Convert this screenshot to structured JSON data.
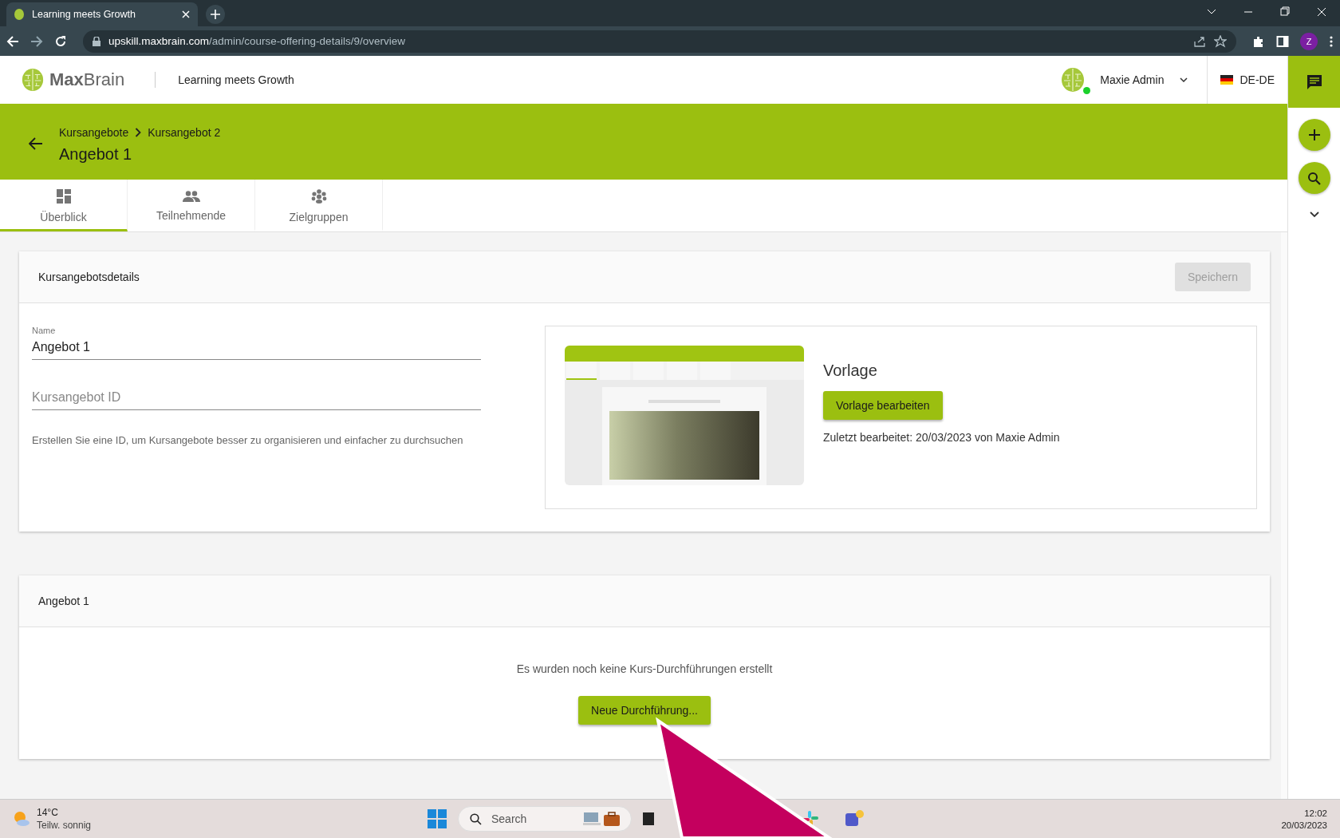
{
  "browser": {
    "tab_title": "Learning meets Growth",
    "url_host": "upskill.maxbrain.com",
    "url_path": "/admin/course-offering-details/9/overview",
    "profile_initial": "Z"
  },
  "header": {
    "logo_bold": "Max",
    "logo_light": "Brain",
    "tagline": "Learning meets Growth",
    "user_name": "Maxie Admin",
    "user_online": true,
    "language": "DE-DE"
  },
  "banner": {
    "breadcrumbs": [
      "Kursangebote",
      "Kursangebot 2"
    ],
    "title": "Angebot 1"
  },
  "tabs": [
    {
      "label": "Überblick",
      "kind": "dashboard",
      "selected": true
    },
    {
      "label": "Teilnehmende",
      "kind": "people",
      "selected": false
    },
    {
      "label": "Zielgruppen",
      "kind": "groups",
      "selected": false
    }
  ],
  "details_card": {
    "title": "Kursangebotsdetails",
    "save_button": {
      "label": "Speichern",
      "disabled": true
    },
    "fields": [
      {
        "label": "Name",
        "value": "Angebot 1"
      },
      {
        "placeholder": "Kursangebot ID"
      }
    ],
    "hint": "Erstellen Sie eine ID, um Kursangebote besser zu organisieren und einfacher zu durchsuchen",
    "template": {
      "title": "Vorlage",
      "button": "Vorlage bearbeiten",
      "last_edited": "Zuletzt bearbeitet: 20/03/2023 von Maxie Admin"
    }
  },
  "offering_card": {
    "title": "Angebot 1",
    "empty_message": "Es wurden noch keine Kurs-Durchführungen erstellt",
    "button": "Neue Durchführung..."
  },
  "taskbar": {
    "temperature": "14°C",
    "weather": "Teilw. sonnig",
    "search_placeholder": "Search",
    "time": "12:02",
    "date": "20/03/2023"
  }
}
